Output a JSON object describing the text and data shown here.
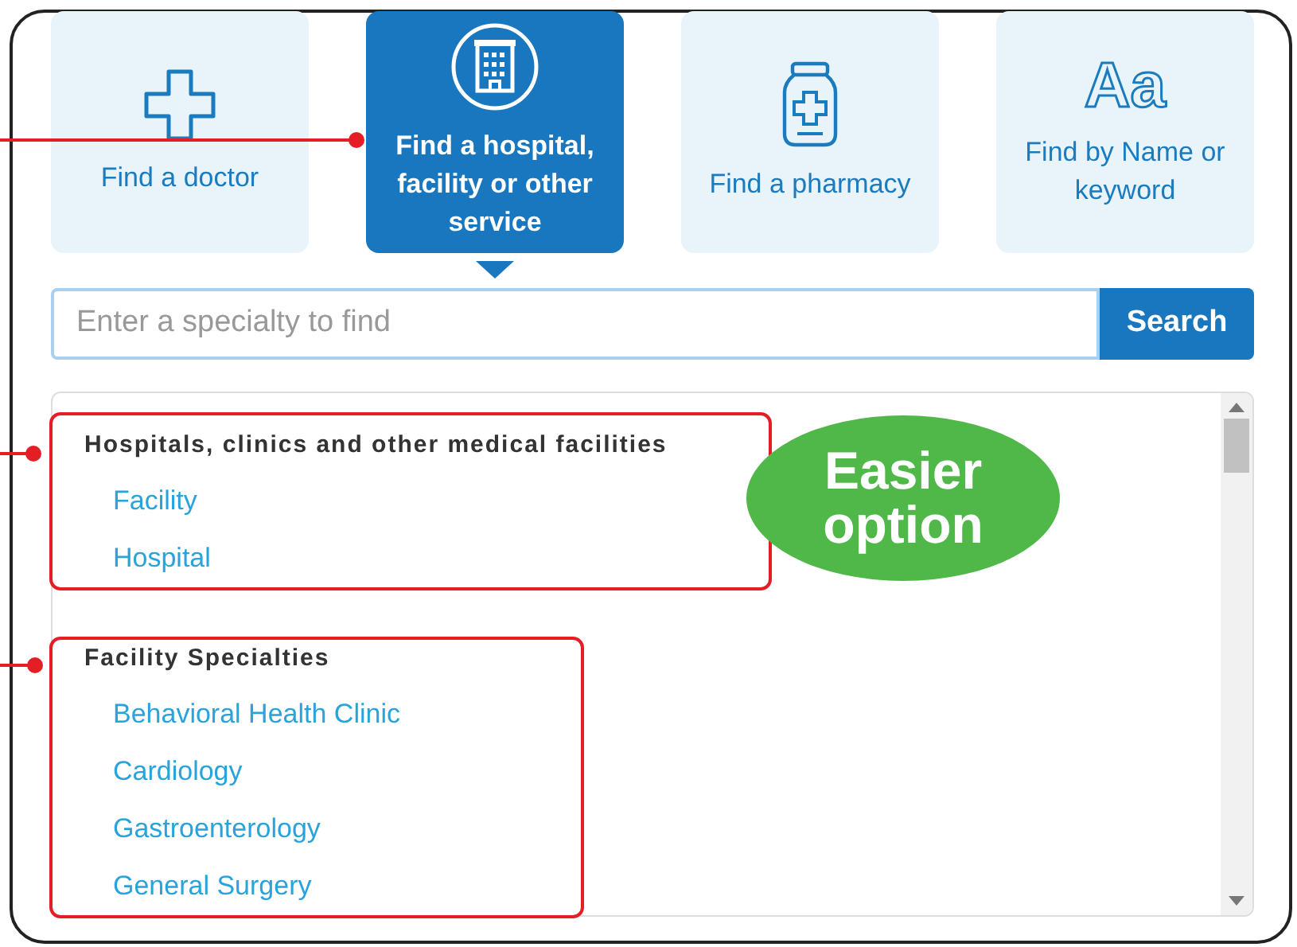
{
  "tiles": [
    {
      "kind": "doctor",
      "label": "Find a doctor",
      "selected": false
    },
    {
      "kind": "hospital",
      "label": "Find a hospital, facility or other service",
      "selected": true
    },
    {
      "kind": "pharmacy",
      "label": "Find a pharmacy",
      "selected": false
    },
    {
      "kind": "name",
      "icon_text": "Aa",
      "label": "Find by Name or keyword",
      "selected": false
    }
  ],
  "search": {
    "placeholder": "Enter a specialty to find",
    "button": "Search"
  },
  "groups": [
    {
      "heading": "Hospitals, clinics and other medical facilities",
      "items": [
        "Facility",
        "Hospital"
      ]
    },
    {
      "heading": "Facility Specialties",
      "items": [
        "Behavioral Health Clinic",
        "Cardiology",
        "Gastroenterology",
        "General Surgery"
      ]
    }
  ],
  "callout": {
    "lines": [
      "Easier",
      "option"
    ]
  }
}
